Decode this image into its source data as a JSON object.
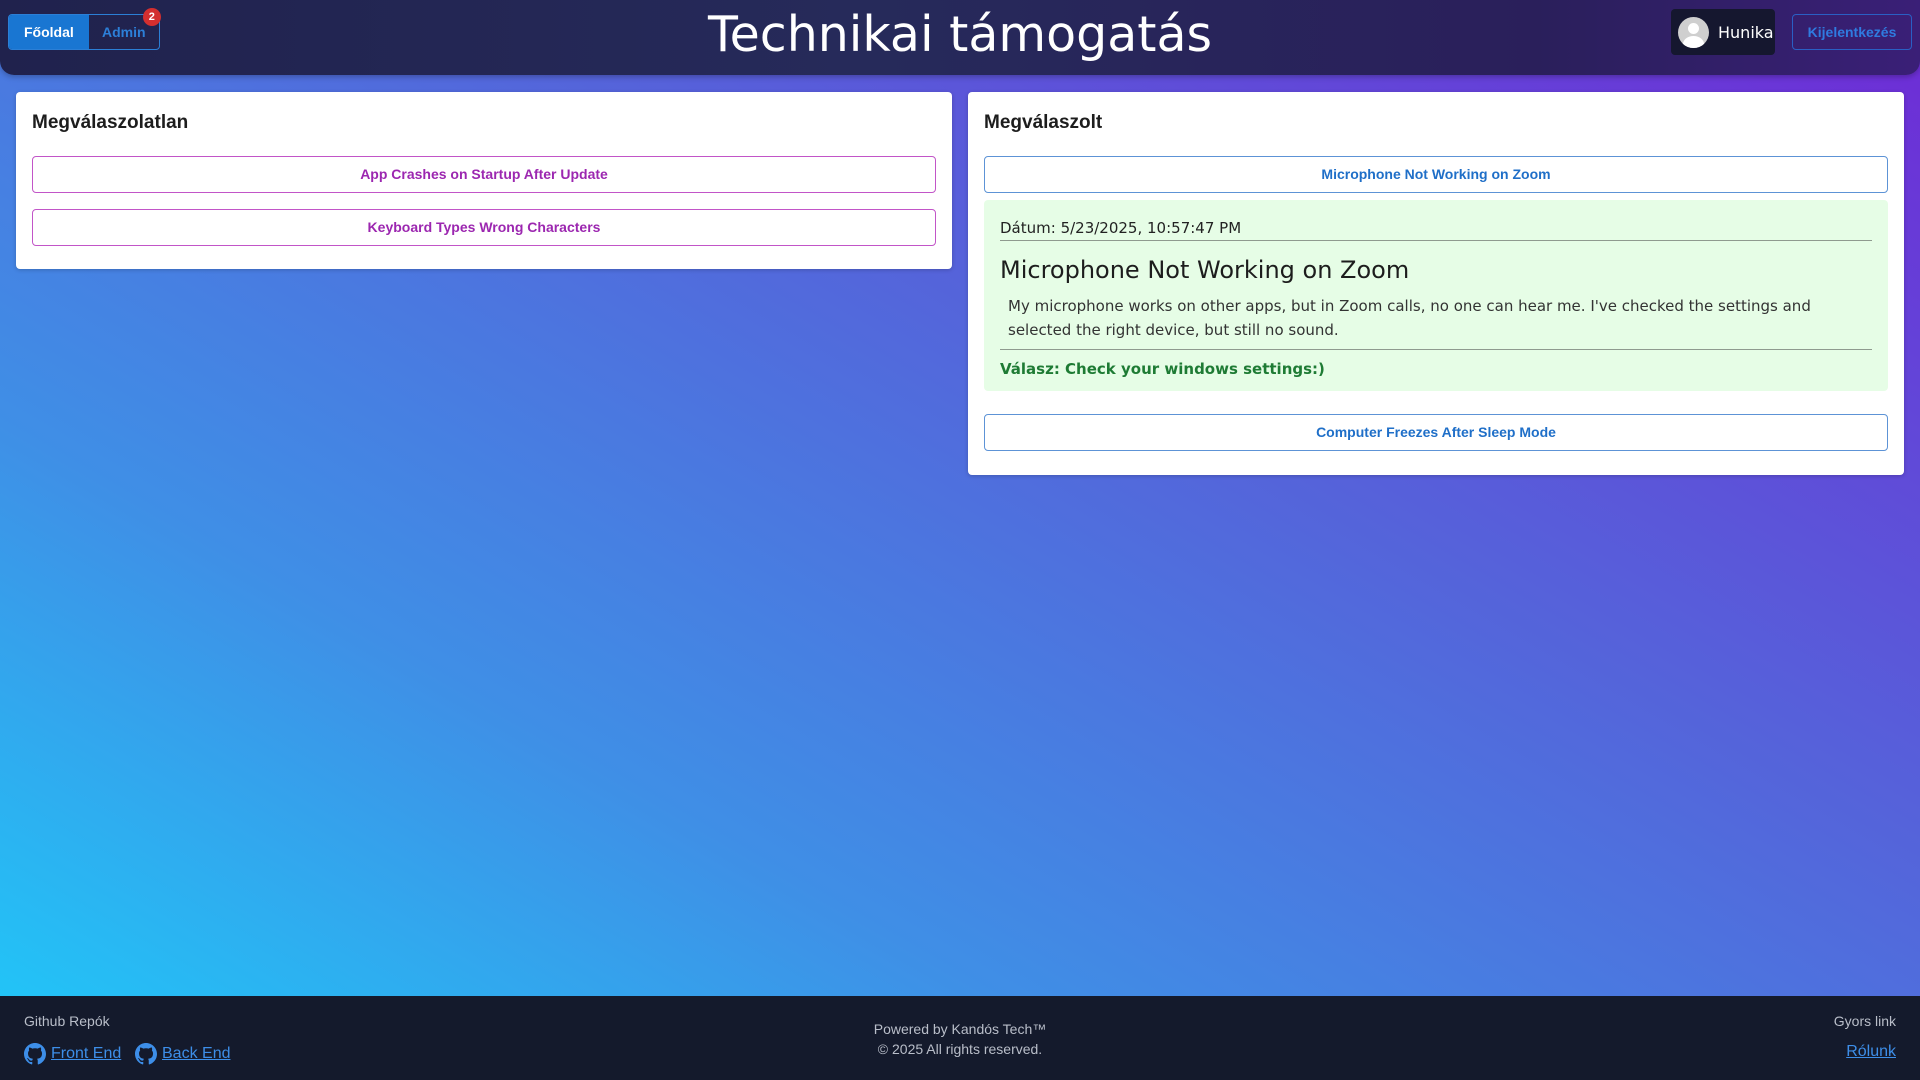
{
  "nav": {
    "home_label": "Főoldal",
    "admin_label": "Admin",
    "admin_badge": "2"
  },
  "header": {
    "title": "Technikai támogatás",
    "user_name": "Hunika",
    "logout_label": "Kijelentkezés"
  },
  "unanswered": {
    "title": "Megválaszolatlan",
    "items": [
      {
        "label": "App Crashes on Startup After Update"
      },
      {
        "label": "Keyboard Types Wrong Characters"
      }
    ]
  },
  "answered": {
    "title": "Megválaszolt",
    "items": [
      {
        "label": "Microphone Not Working on Zoom"
      },
      {
        "label": "Computer Freezes After Sleep Mode"
      }
    ],
    "detail": {
      "date": "Dátum: 5/23/2025, 10:57:47 PM",
      "title": "Microphone Not Working on Zoom",
      "body": "My microphone works on other apps, but in Zoom calls, no one can hear me. I've checked the settings and selected the right device, but still no sound.",
      "answer": "Válasz: Check your windows settings:)"
    }
  },
  "footer": {
    "repos_heading": "Github Repók",
    "frontend_label": "Front End",
    "backend_label": "Back End",
    "powered_by": "Powered by Kandós Tech™",
    "copyright": "© 2025 All rights reserved.",
    "quick_link_heading": "Gyors link",
    "about_label": "Rólunk"
  },
  "colors": {
    "primary": "#1976d2",
    "pink_accent": "#9c27b0",
    "answer_green": "#1e7b34",
    "detail_bg": "#e6fde6",
    "badge_red": "#d32f2f"
  },
  "icons": [
    "github-icon",
    "avatar-icon"
  ]
}
